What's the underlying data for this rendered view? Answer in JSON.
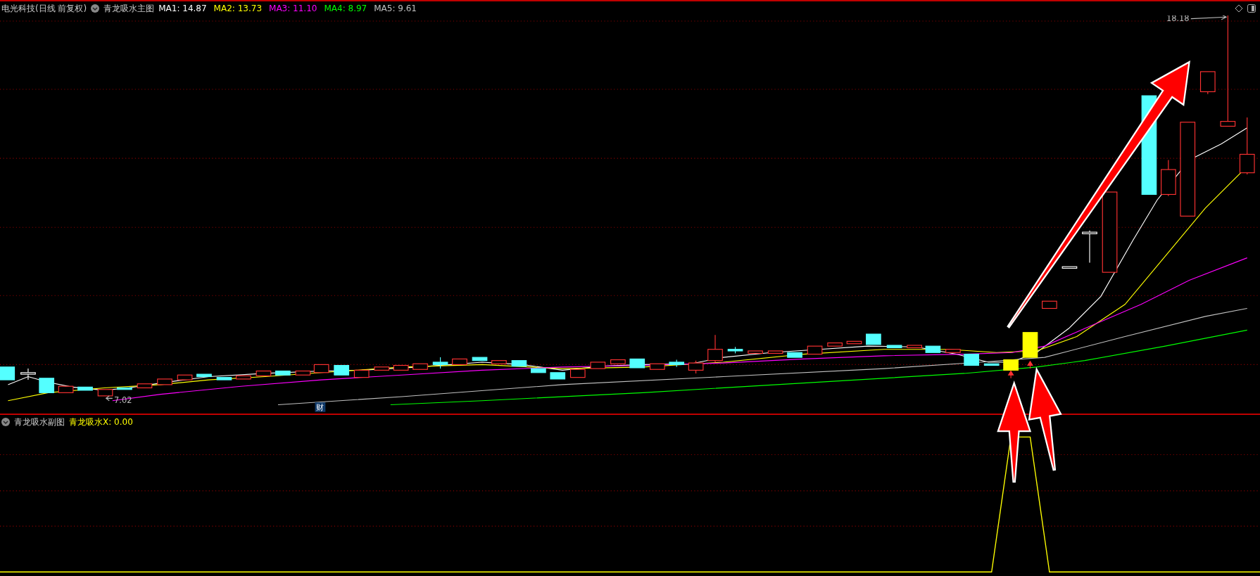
{
  "main_panel": {
    "stock_title": "电光科技(日线 前复权)",
    "indicator": "青龙吸水主图",
    "moving_averages": [
      {
        "label": "MA1: 14.87",
        "color": "#ffffff"
      },
      {
        "label": "MA2: 13.73",
        "color": "#ffff00"
      },
      {
        "label": "MA3: 11.10",
        "color": "#ff00ff"
      },
      {
        "label": "MA4: 8.97",
        "color": "#00ff00"
      },
      {
        "label": "MA5: 9.61",
        "color": "#c0c0c0"
      }
    ],
    "high_label": "18.18",
    "low_label": "7.02",
    "event_badge": "财"
  },
  "sub_panel": {
    "indicator": "青龙吸水副图",
    "value_label": "青龙吸水X: 0.00"
  }
}
